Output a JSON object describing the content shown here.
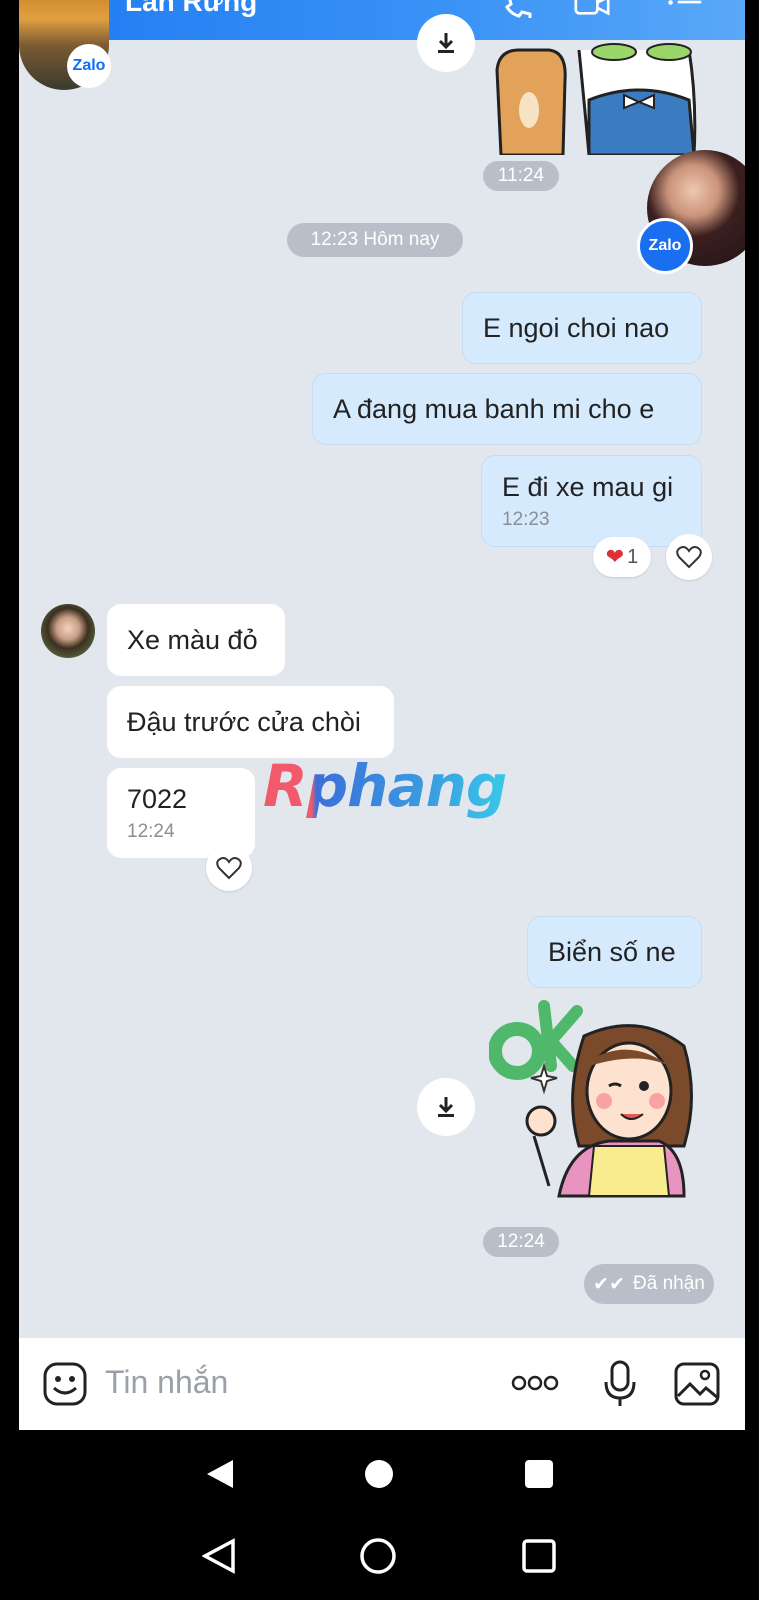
{
  "header": {
    "contact_name": "Lan Rưng"
  },
  "badges": {
    "zalo_label": "Zalo"
  },
  "messages": {
    "time_1124": "11:24",
    "date_separator": "12:23 Hôm nay",
    "out_1": "E ngoi choi nao",
    "out_2": "A đang mua banh mi cho e",
    "out_3": "E đi xe mau gi",
    "out_3_time": "12:23",
    "reaction_count": "1",
    "in_1": "Xe màu đỏ",
    "in_2": "Đậu trước cửa chòi",
    "in_3": "7022",
    "in_3_time": "12:24",
    "out_4": "Biển số ne",
    "sticker_time": "12:24",
    "status": "Đã nhận"
  },
  "watermark": "Rphang",
  "input": {
    "placeholder": "Tin nhắn"
  },
  "icons": [
    "phone-icon",
    "video-icon",
    "menu-icon",
    "download-icon",
    "heart-icon",
    "emoji-icon",
    "more-icon",
    "mic-icon",
    "image-icon",
    "back-icon",
    "home-icon",
    "recents-icon"
  ],
  "colors": {
    "header": "#2f86f4",
    "chat_background": "#e2e7ee",
    "my_bubble": "#d5eafd",
    "their_bubble": "#ffffff",
    "reaction_heart": "#e02f35"
  }
}
